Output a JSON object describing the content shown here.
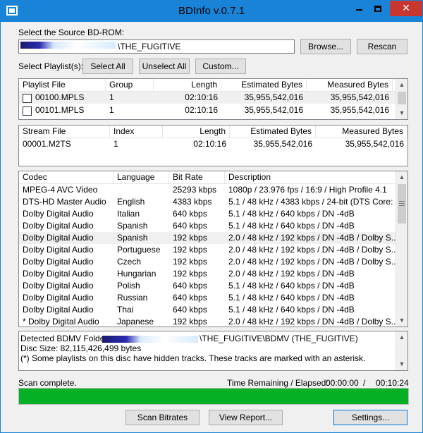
{
  "window": {
    "title": "BDInfo v.0.7.1",
    "close_glyph": "✕"
  },
  "source": {
    "label": "Select the Source BD-ROM:",
    "path_value": "\\THE_FUGITIVE",
    "browse_label": "Browse...",
    "rescan_label": "Rescan"
  },
  "playlists": {
    "label": "Select Playlist(s):",
    "select_all_label": "Select All",
    "unselect_all_label": "Unselect All",
    "custom_label": "Custom...",
    "columns": [
      "Playlist File",
      "Group",
      "Length",
      "Estimated Bytes",
      "Measured Bytes"
    ],
    "rows": [
      {
        "file": "00100.MPLS",
        "group": "1",
        "length": "02:10:16",
        "estimated": "35,955,542,016",
        "measured": "35,955,542,016"
      },
      {
        "file": "00101.MPLS",
        "group": "1",
        "length": "02:10:16",
        "estimated": "35,955,542,016",
        "measured": "35,955,542,016"
      }
    ]
  },
  "streams": {
    "columns": [
      "Stream File",
      "Index",
      "Length",
      "Estimated Bytes",
      "Measured Bytes"
    ],
    "rows": [
      {
        "file": "00001.M2TS",
        "index": "1",
        "length": "02:10:16",
        "estimated": "35,955,542,016",
        "measured": "35,955,542,016"
      }
    ]
  },
  "codecs": {
    "columns": [
      "Codec",
      "Language",
      "Bit Rate",
      "Description"
    ],
    "rows": [
      {
        "codec": "MPEG-4 AVC Video",
        "language": "",
        "bitrate": "25293 kbps",
        "description": "1080p / 23.976 fps / 16:9 / High Profile 4.1"
      },
      {
        "codec": "DTS-HD Master Audio",
        "language": "English",
        "bitrate": "4383 kbps",
        "description": "5.1 / 48 kHz / 4383 kbps / 24-bit (DTS Core: ..."
      },
      {
        "codec": "Dolby Digital Audio",
        "language": "Italian",
        "bitrate": "640 kbps",
        "description": "5.1 / 48 kHz / 640 kbps / DN -4dB"
      },
      {
        "codec": "Dolby Digital Audio",
        "language": "Spanish",
        "bitrate": "640 kbps",
        "description": "5.1 / 48 kHz / 640 kbps / DN -4dB"
      },
      {
        "codec": "Dolby Digital Audio",
        "language": "Spanish",
        "bitrate": "192 kbps",
        "description": "2.0 / 48 kHz / 192 kbps / DN -4dB / Dolby S..."
      },
      {
        "codec": "Dolby Digital Audio",
        "language": "Portuguese",
        "bitrate": "192 kbps",
        "description": "2.0 / 48 kHz / 192 kbps / DN -4dB / Dolby S..."
      },
      {
        "codec": "Dolby Digital Audio",
        "language": "Czech",
        "bitrate": "192 kbps",
        "description": "2.0 / 48 kHz / 192 kbps / DN -4dB / Dolby S..."
      },
      {
        "codec": "Dolby Digital Audio",
        "language": "Hungarian",
        "bitrate": "192 kbps",
        "description": "2.0 / 48 kHz / 192 kbps / DN -4dB"
      },
      {
        "codec": "Dolby Digital Audio",
        "language": "Polish",
        "bitrate": "640 kbps",
        "description": "5.1 / 48 kHz / 640 kbps / DN -4dB"
      },
      {
        "codec": "Dolby Digital Audio",
        "language": "Russian",
        "bitrate": "640 kbps",
        "description": "5.1 / 48 kHz / 640 kbps / DN -4dB"
      },
      {
        "codec": "Dolby Digital Audio",
        "language": "Thai",
        "bitrate": "640 kbps",
        "description": "5.1 / 48 kHz / 640 kbps / DN -4dB"
      },
      {
        "codec": "* Dolby Digital Audio",
        "language": "Japanese",
        "bitrate": "192 kbps",
        "description": "2.0 / 48 kHz / 192 kbps / DN -4dB / Dolby S..."
      }
    ]
  },
  "info": {
    "detected_label": "Detected BDMV Folder:",
    "detected_value": "\\THE_FUGITIVE\\BDMV (THE_FUGITIVE)",
    "disc_size": "Disc Size: 82,115,426,499 bytes",
    "hidden_note": "(*) Some playlists on this disc have hidden tracks. These tracks are marked with an asterisk."
  },
  "status": {
    "text": "Scan complete.",
    "time_label": "Time Remaining / Elapsed:",
    "remaining": "00:00:00",
    "separator": "/",
    "elapsed": "00:10:24",
    "progress_percent": 100
  },
  "footer": {
    "scan_label": "Scan Bitrates",
    "report_label": "View Report...",
    "settings_label": "Settings..."
  },
  "colors": {
    "titlebar": "#1883d7",
    "progress": "#06b025",
    "close": "#c7372f"
  }
}
